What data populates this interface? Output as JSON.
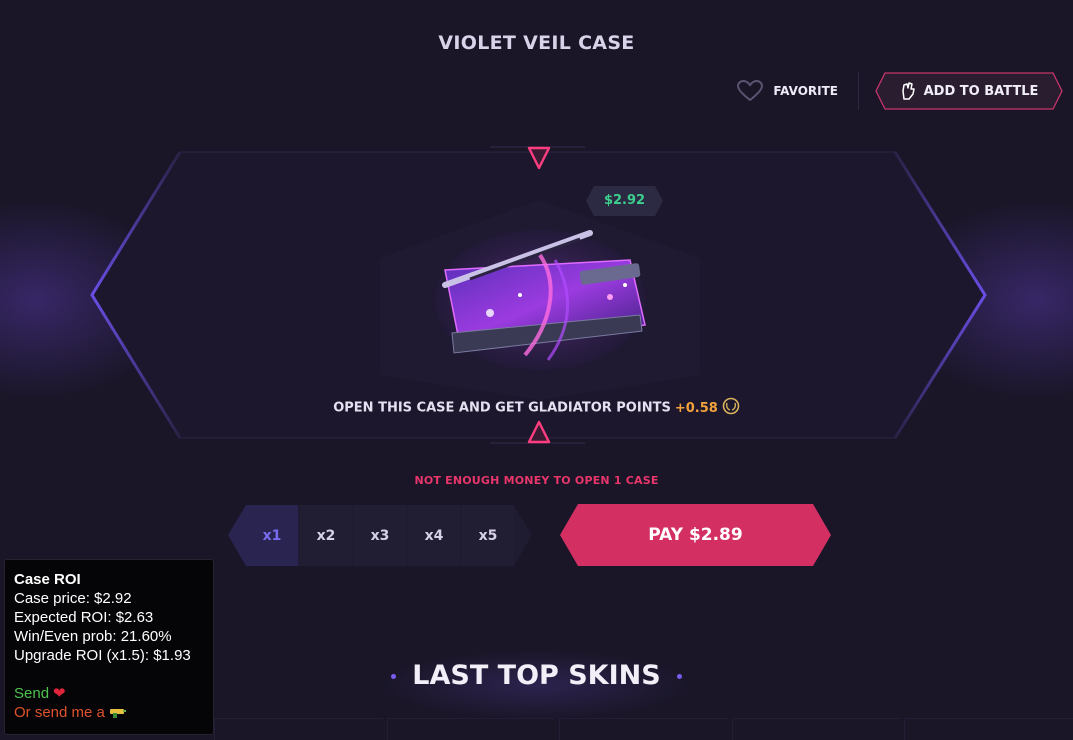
{
  "header": {
    "title": "VIOLET VEIL CASE",
    "favorite_label": "FAVORITE",
    "battle_label": "ADD TO BATTLE"
  },
  "case": {
    "price": "$2.92",
    "points_text": "OPEN THIS CASE AND GET GLADIATOR POINTS",
    "points_value": "+0.58"
  },
  "open": {
    "warning": "NOT ENOUGH MONEY TO OPEN 1 CASE",
    "multipliers": [
      "x1",
      "x2",
      "x3",
      "x4",
      "x5"
    ],
    "selected": "x1",
    "pay_label": "PAY $2.89"
  },
  "section": {
    "title": "LAST TOP SKINS"
  },
  "roi_panel": {
    "title": "Case ROI",
    "case_price": "Case price: $2.92",
    "expected_roi": "Expected ROI: $2.63",
    "win_prob": "Win/Even prob: 21.60%",
    "upgrade_roi": "Upgrade ROI (x1.5): $1.93",
    "send_text": "Send",
    "send_alt_text": "Or send me a"
  },
  "colors": {
    "background": "#1a1628",
    "accent_pink": "#d8305f",
    "accent_violet": "#6b4fe0",
    "price_green": "#3ccf8e",
    "points_orange": "#f3a23b"
  },
  "icons": [
    "heart-icon",
    "fist-icon",
    "arrow-down-icon",
    "arrow-up-icon",
    "laurel-coin-icon",
    "heart-emoji-icon",
    "water-gun-icon"
  ]
}
